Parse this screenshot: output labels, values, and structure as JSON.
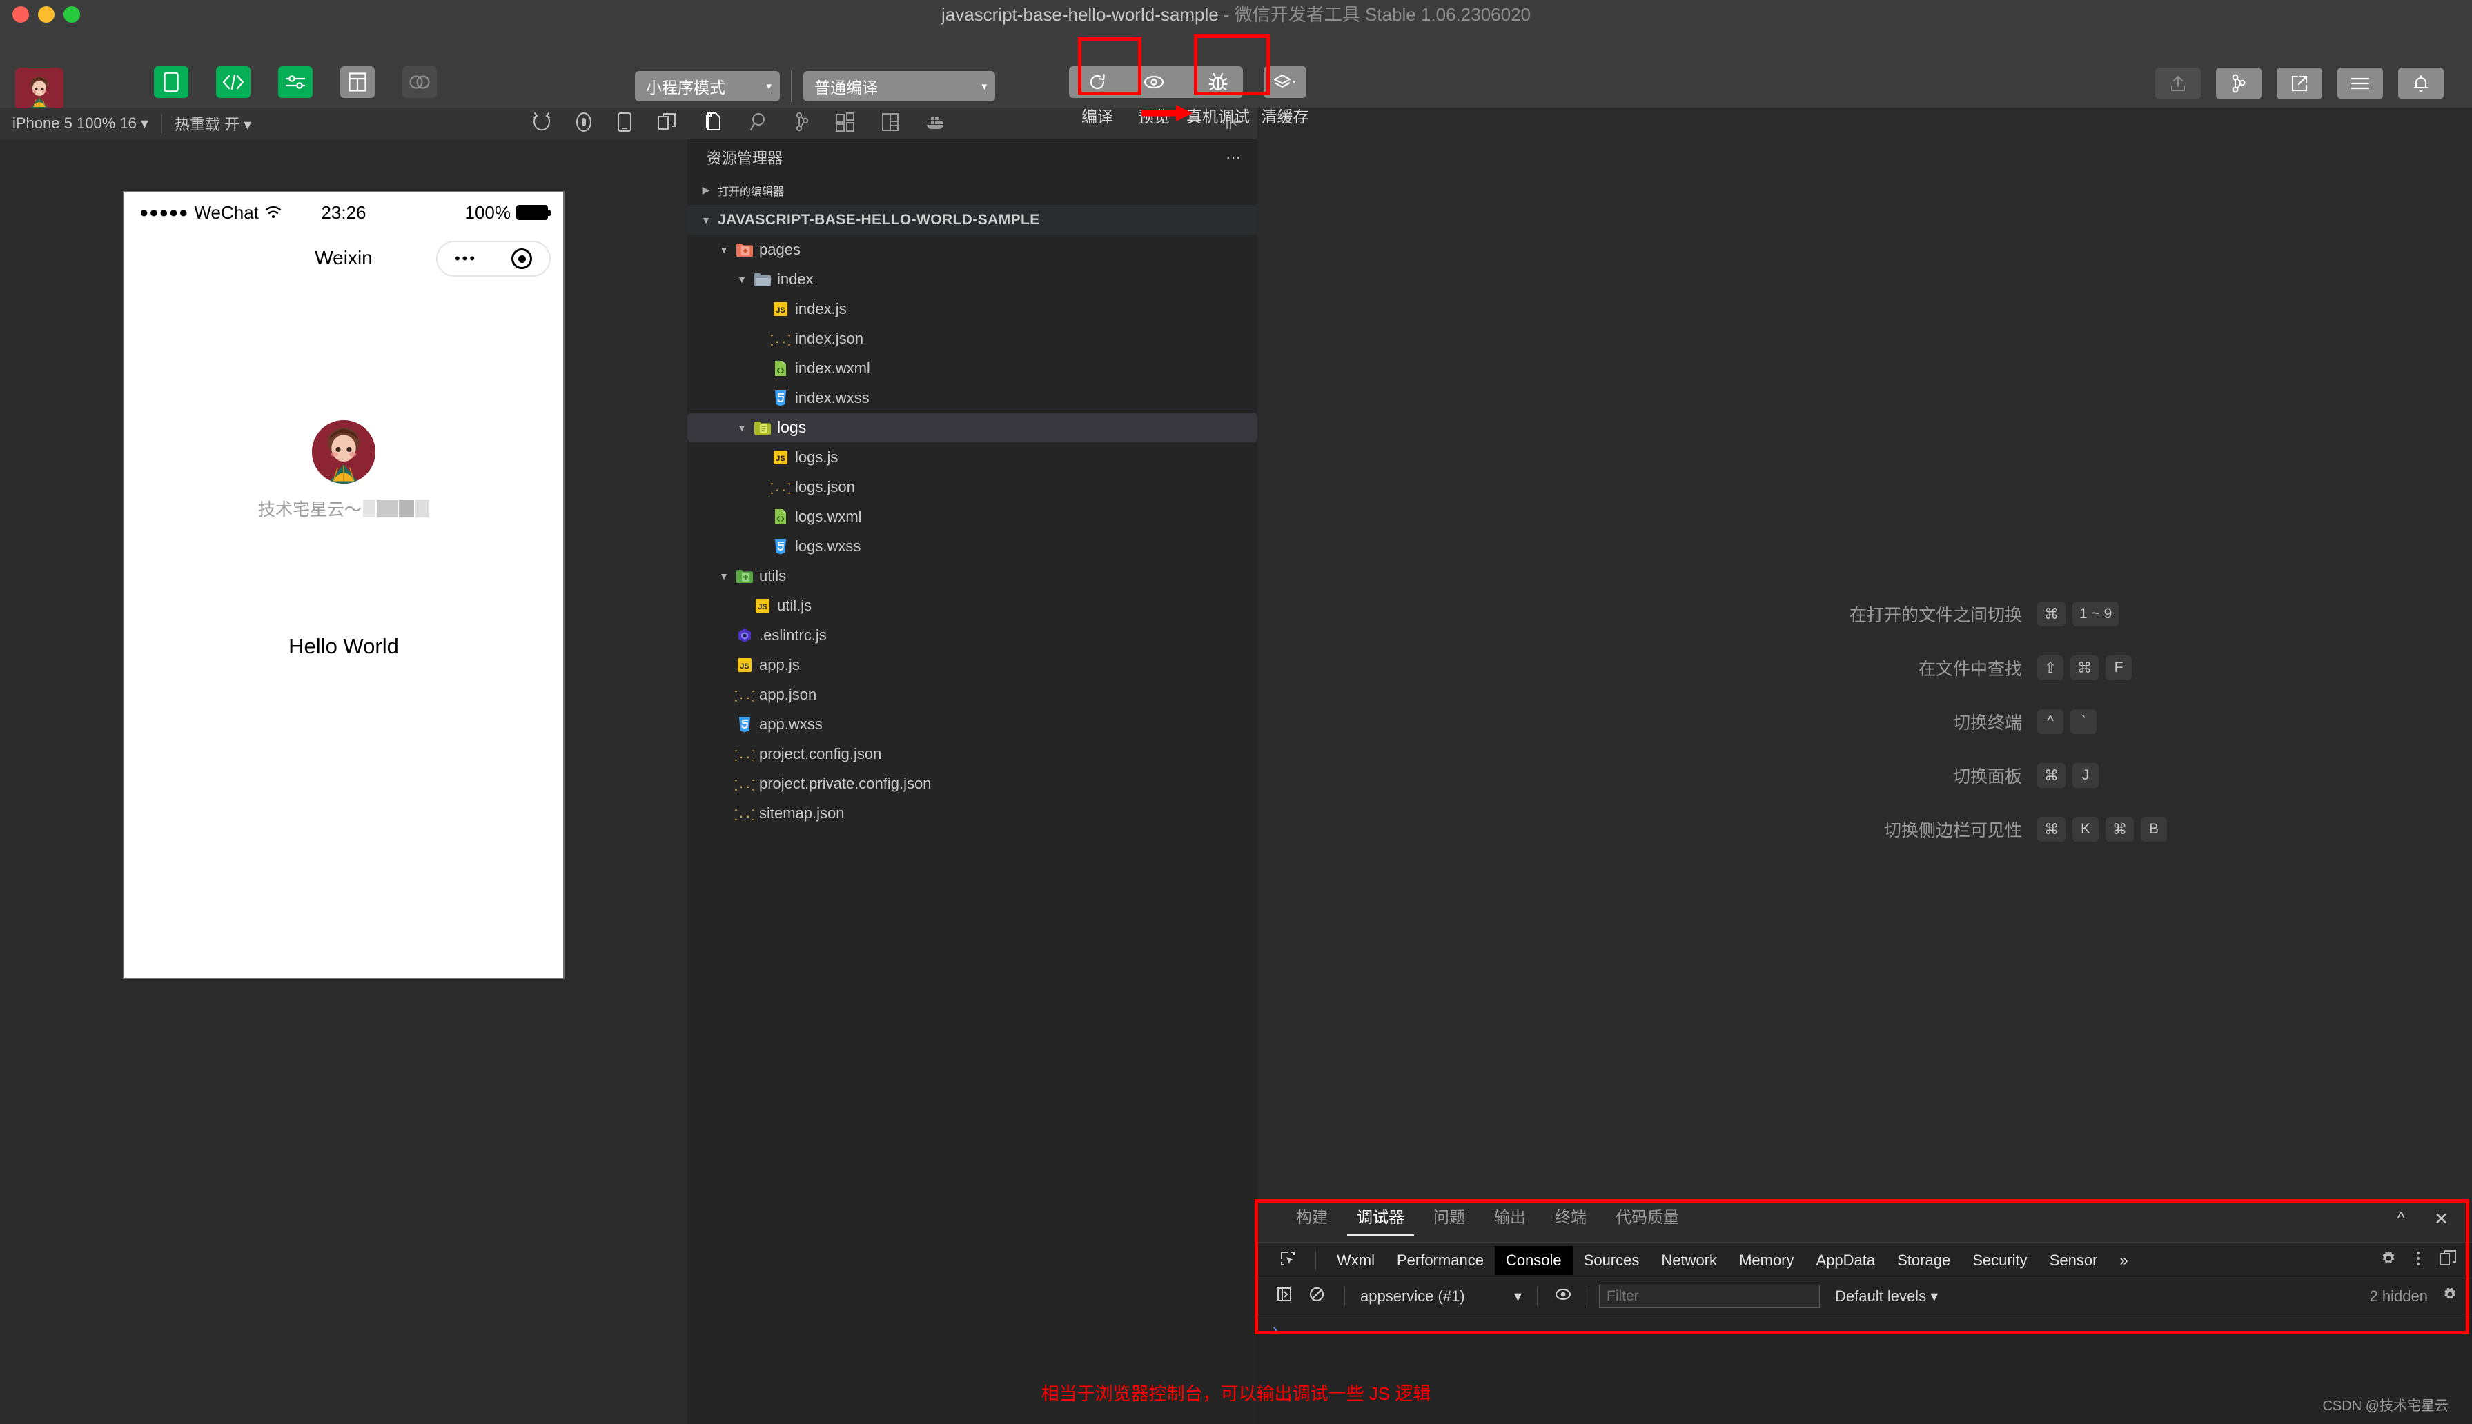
{
  "window": {
    "title": "javascript-base-hello-world-sample",
    "title_separator": " - ",
    "app_name": "微信开发者工具 Stable 1.06.2306020"
  },
  "toolbar": {
    "mode_buttons": [
      {
        "label": "模拟器",
        "icon": "phone-icon",
        "state": "active"
      },
      {
        "label": "编辑器",
        "icon": "code-icon",
        "state": "active"
      },
      {
        "label": "调试器",
        "icon": "sliders-icon",
        "state": "active"
      },
      {
        "label": "可视化",
        "icon": "layout-icon",
        "state": "inactive"
      },
      {
        "label": "云开发",
        "icon": "cloud-icon",
        "state": "disabled"
      }
    ],
    "mode_select": "小程序模式",
    "compile_select": "普通编译",
    "run_buttons": [
      {
        "label": "编译",
        "icon": "refresh-icon"
      },
      {
        "label": "预览",
        "icon": "eye-icon"
      },
      {
        "label": "真机调试",
        "icon": "bug-icon"
      },
      {
        "label": "清缓存",
        "icon": "layers-icon"
      }
    ],
    "right_buttons": [
      {
        "label": "上传",
        "icon": "upload-icon",
        "state": "disabled"
      },
      {
        "label": "版本管理",
        "icon": "branch-icon",
        "state": "enabled"
      },
      {
        "label": "测试号",
        "icon": "external-link-icon",
        "state": "enabled"
      },
      {
        "label": "详情",
        "icon": "menu-icon",
        "state": "enabled"
      },
      {
        "label": "消息",
        "icon": "bell-icon",
        "state": "enabled"
      }
    ]
  },
  "device_bar": {
    "device": "iPhone 5 100% 16",
    "hot_reload": "热重载 开",
    "icons": [
      "rotate-icon",
      "record-icon",
      "phone-outline-icon",
      "multi-window-icon"
    ]
  },
  "simulator": {
    "status_bar": {
      "dots": "●●●●●",
      "carrier": "WeChat",
      "wifi": "wifi-icon",
      "time": "23:26",
      "battery_percent": "100%"
    },
    "nav_title": "Weixin",
    "capsule": {
      "dots": "•••",
      "target": "target-icon"
    },
    "user_name": "技术宅星云～",
    "hello_text": "Hello World"
  },
  "activity_bar": {
    "icons": [
      "files-icon",
      "search-icon",
      "source-control-icon",
      "extensions-icon",
      "layout-icon",
      "docker-icon",
      "collapse-sidebar-icon"
    ]
  },
  "explorer": {
    "header": "资源管理器",
    "menu": "···",
    "open_editors": "打开的编辑器",
    "project_root": "JAVASCRIPT-BASE-HELLO-WORLD-SAMPLE",
    "tree": [
      {
        "label": "pages",
        "type": "folder",
        "icon": "folder-pages-icon",
        "depth": 1,
        "expanded": true,
        "selected": false
      },
      {
        "label": "index",
        "type": "folder",
        "icon": "folder-icon",
        "depth": 2,
        "expanded": true,
        "selected": false
      },
      {
        "label": "index.js",
        "type": "js",
        "icon": "js-icon",
        "depth": 3,
        "selected": false
      },
      {
        "label": "index.json",
        "type": "json",
        "icon": "json-icon",
        "depth": 3,
        "selected": false
      },
      {
        "label": "index.wxml",
        "type": "wxml",
        "icon": "wxml-icon",
        "depth": 3,
        "selected": false
      },
      {
        "label": "index.wxss",
        "type": "wxss",
        "icon": "wxss-icon",
        "depth": 3,
        "selected": false
      },
      {
        "label": "logs",
        "type": "folder",
        "icon": "folder-logs-icon",
        "depth": 2,
        "expanded": true,
        "selected": true
      },
      {
        "label": "logs.js",
        "type": "js",
        "icon": "js-icon",
        "depth": 3,
        "selected": false
      },
      {
        "label": "logs.json",
        "type": "json",
        "icon": "json-icon",
        "depth": 3,
        "selected": false
      },
      {
        "label": "logs.wxml",
        "type": "wxml",
        "icon": "wxml-icon",
        "depth": 3,
        "selected": false
      },
      {
        "label": "logs.wxss",
        "type": "wxss",
        "icon": "wxss-icon",
        "depth": 3,
        "selected": false
      },
      {
        "label": "utils",
        "type": "folder",
        "icon": "folder-utils-icon",
        "depth": 1,
        "expanded": true,
        "selected": false
      },
      {
        "label": "util.js",
        "type": "js",
        "icon": "js-icon",
        "depth": 2,
        "selected": false
      },
      {
        "label": ".eslintrc.js",
        "type": "eslint",
        "icon": "eslint-icon",
        "depth": 1,
        "selected": false
      },
      {
        "label": "app.js",
        "type": "js",
        "icon": "js-icon",
        "depth": 1,
        "selected": false
      },
      {
        "label": "app.json",
        "type": "json",
        "icon": "json-icon",
        "depth": 1,
        "selected": false
      },
      {
        "label": "app.wxss",
        "type": "wxss",
        "icon": "wxss-icon",
        "depth": 1,
        "selected": false
      },
      {
        "label": "project.config.json",
        "type": "json",
        "icon": "json-icon",
        "depth": 1,
        "selected": false
      },
      {
        "label": "project.private.config.json",
        "type": "json",
        "icon": "json-icon",
        "depth": 1,
        "selected": false
      },
      {
        "label": "sitemap.json",
        "type": "json",
        "icon": "json-icon",
        "depth": 1,
        "selected": false
      }
    ]
  },
  "shortcuts": [
    {
      "label": "在打开的文件之间切换",
      "keys": [
        "⌘",
        "1 ~ 9"
      ]
    },
    {
      "label": "在文件中查找",
      "keys": [
        "⇧",
        "⌘",
        "F"
      ]
    },
    {
      "label": "切换终端",
      "keys": [
        "^",
        "`"
      ]
    },
    {
      "label": "切换面板",
      "keys": [
        "⌘",
        "J"
      ]
    },
    {
      "label": "切换侧边栏可见性",
      "keys": [
        "⌘",
        "K",
        "⌘",
        "B"
      ]
    }
  ],
  "panel": {
    "tabs": [
      {
        "label": "构建",
        "active": false
      },
      {
        "label": "调试器",
        "active": true
      },
      {
        "label": "问题",
        "active": false
      },
      {
        "label": "输出",
        "active": false
      },
      {
        "label": "终端",
        "active": false
      },
      {
        "label": "代码质量",
        "active": false
      }
    ],
    "collapse_icon": "chevron-up-icon",
    "close_icon": "close-icon"
  },
  "devtools": {
    "inspect_icon": "inspect-icon",
    "tabs": [
      {
        "label": "Wxml",
        "active": false
      },
      {
        "label": "Performance",
        "active": false
      },
      {
        "label": "Console",
        "active": true
      },
      {
        "label": "Sources",
        "active": false
      },
      {
        "label": "Network",
        "active": false
      },
      {
        "label": "Memory",
        "active": false
      },
      {
        "label": "AppData",
        "active": false
      },
      {
        "label": "Storage",
        "active": false
      },
      {
        "label": "Security",
        "active": false
      },
      {
        "label": "Sensor",
        "active": false
      }
    ],
    "overflow": "»",
    "right_icons": [
      "gear-icon",
      "kebab-menu-icon",
      "dock-icon"
    ],
    "console": {
      "sidebar_icon": "console-sidebar-icon",
      "clear_icon": "clear-console-icon",
      "context": "appservice (#1)",
      "eye_icon": "eye-icon",
      "filter_placeholder": "Filter",
      "filter_value": "",
      "levels": "Default levels",
      "hidden_count": "2 hidden",
      "settings_icon": "gear-icon",
      "prompt": "›"
    }
  },
  "annotations": {
    "console_note": "相当于浏览器控制台，可以输出调试一些 JS 逻辑",
    "highlight_color": "#ff0000"
  },
  "watermark": "CSDN @技术宅星云"
}
